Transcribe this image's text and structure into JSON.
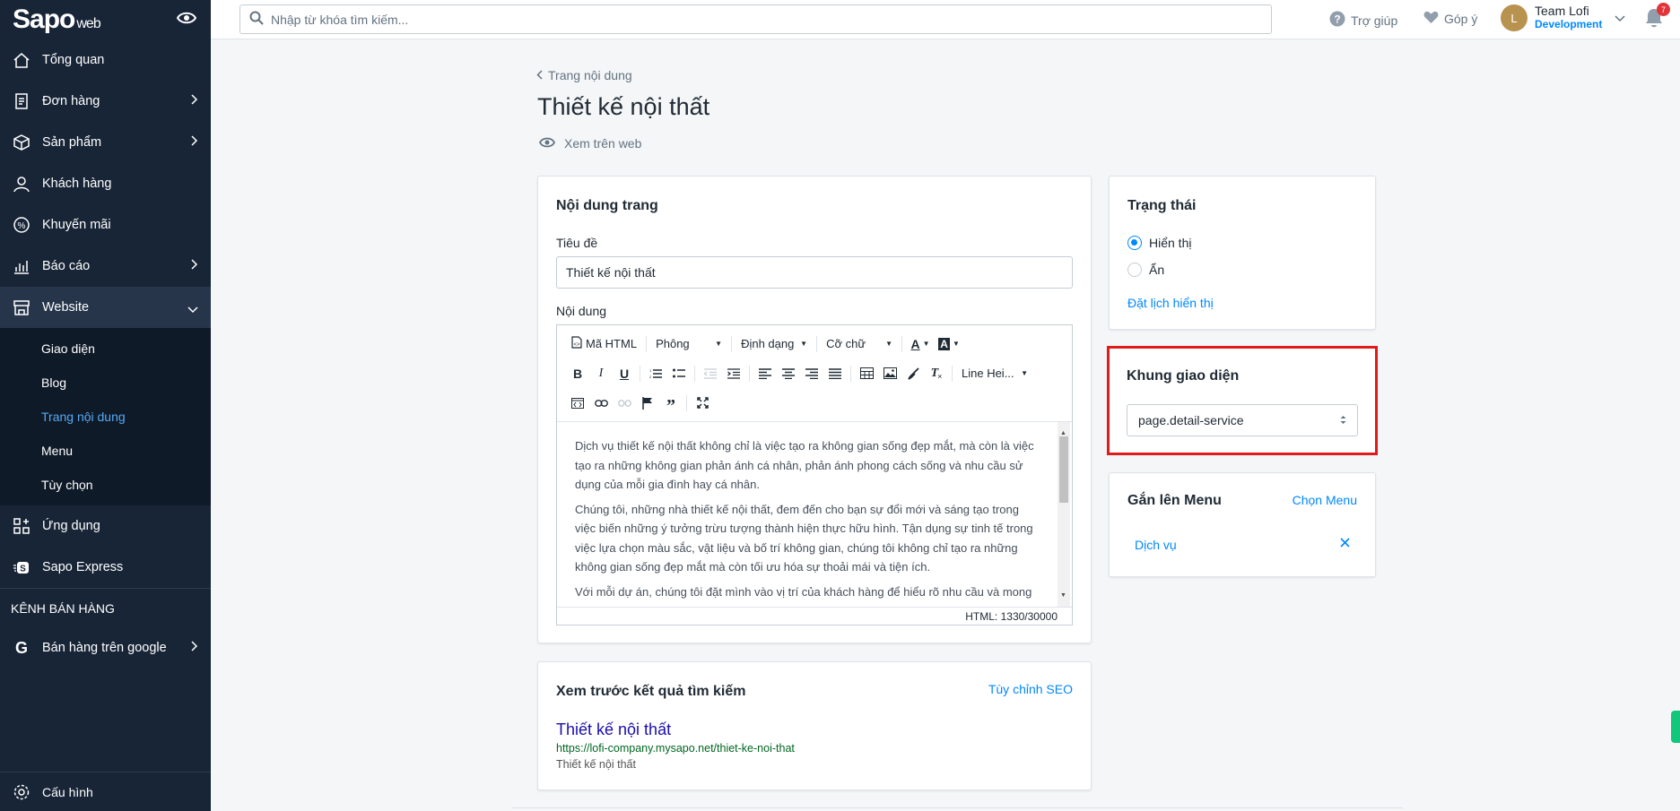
{
  "brand": {
    "logo": "Sapo",
    "logo_suffix": "web"
  },
  "sidebar": {
    "items": [
      {
        "label": "Tổng quan"
      },
      {
        "label": "Đơn hàng"
      },
      {
        "label": "Sản phẩm"
      },
      {
        "label": "Khách hàng"
      },
      {
        "label": "Khuyến mãi"
      },
      {
        "label": "Báo cáo"
      },
      {
        "label": "Website"
      }
    ],
    "website_sub": [
      {
        "label": "Giao diện"
      },
      {
        "label": "Blog"
      },
      {
        "label": "Trang nội dung"
      },
      {
        "label": "Menu"
      },
      {
        "label": "Tùy chọn"
      }
    ],
    "apps": "Ứng dụng",
    "express": "Sapo Express",
    "channels_label": "KÊNH BÁN HÀNG",
    "google": "Bán hàng trên google",
    "settings": "Cấu hình"
  },
  "topbar": {
    "search_placeholder": "Nhập từ khóa tìm kiếm...",
    "help": "Trợ giúp",
    "feedback": "Góp ý",
    "user_initial": "L",
    "user_name": "Team Lofi",
    "user_store": "Development",
    "notifications": "7"
  },
  "page": {
    "breadcrumb": "Trang nội dung",
    "title": "Thiết kế nội thất",
    "view_on_web": "Xem trên web"
  },
  "content_card": {
    "title": "Nội dung trang",
    "title_label": "Tiêu đề",
    "title_value": "Thiết kế nội thất",
    "content_label": "Nội dung",
    "toolbar": {
      "html": "Mã HTML",
      "font": "Phông",
      "format": "Định dạng",
      "size": "Cỡ chữ",
      "line_height": "Line Hei..."
    },
    "paragraphs": [
      "Dịch vụ thiết kế nội thất không chỉ là việc tạo ra không gian sống đẹp mắt, mà còn là việc tạo ra những không gian phản ánh cá nhân, phản ánh phong cách sống và nhu cầu sử dụng của mỗi gia đình hay cá nhân.",
      "Chúng tôi, những nhà thiết kế nội thất, đem đến cho bạn sự đổi mới và sáng tạo trong việc biến những ý tưởng trừu tượng thành hiện thực hữu hình. Tận dụng sự tinh tế trong việc lựa chọn màu sắc, vật liệu và bố trí không gian, chúng tôi không chỉ tạo ra những không gian sống đẹp mắt mà còn tối ưu hóa sự thoải mái và tiện ích.",
      "Với mỗi dự án, chúng tôi đặt mình vào vị trí của khách hàng để hiểu rõ nhu cầu và mong"
    ],
    "status": "HTML: 1330/30000"
  },
  "seo_card": {
    "title": "Xem trước kết quả tìm kiếm",
    "customize": "Tùy chỉnh SEO",
    "seo_title": "Thiết kế nội thất",
    "url": "https://lofi-company.mysapo.net/thiet-ke-noi-that",
    "description": "Thiết kế nội thất"
  },
  "status_card": {
    "title": "Trạng thái",
    "visible": "Hiển thị",
    "hidden": "Ẩn",
    "schedule": "Đặt lịch hiển thị"
  },
  "template_card": {
    "title": "Khung giao diện",
    "value": "page.detail-service"
  },
  "menu_card": {
    "title": "Gắn lên Menu",
    "choose": "Chọn Menu",
    "item": "Dịch vụ"
  },
  "colors": {
    "sidebar": "#182537",
    "accent": "#0088ff",
    "highlight": "#e01b1b"
  }
}
